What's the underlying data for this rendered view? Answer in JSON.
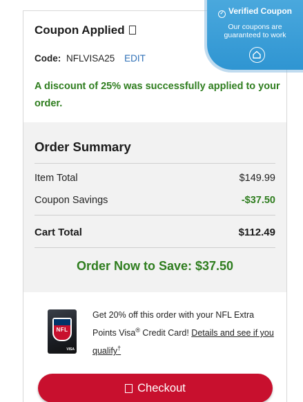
{
  "coupon": {
    "title": "Coupon Applied",
    "code_label": "Code:",
    "code_value": "NFLVISA25",
    "edit_label": "EDIT",
    "message": "A discount of 25% was successfully applied to your order."
  },
  "summary": {
    "title": "Order Summary",
    "item_total_label": "Item Total",
    "item_total_value": "$149.99",
    "savings_label": "Coupon Savings",
    "savings_value": "-$37.50",
    "cart_total_label": "Cart Total",
    "cart_total_value": "$112.49",
    "order_now": "Order Now to Save: $37.50"
  },
  "offer": {
    "text_before": "Get 20% off this order with your NFL Extra Points Visa",
    "registered": "®",
    "text_middle": " Credit Card! ",
    "link": "Details and see if you qualify",
    "dagger": "†",
    "card_brand": "NFL",
    "card_network": "VISA"
  },
  "checkout": {
    "label": "Checkout"
  },
  "badge": {
    "title": "Verified Coupon",
    "subtitle_line1": "Our coupons are",
    "subtitle_line2": "guaranteed to work"
  },
  "colors": {
    "accent_green": "#2e7d1e",
    "checkout_red": "#c8102e",
    "badge_blue": "#3a9fd8",
    "link_blue": "#2d6fb6"
  }
}
